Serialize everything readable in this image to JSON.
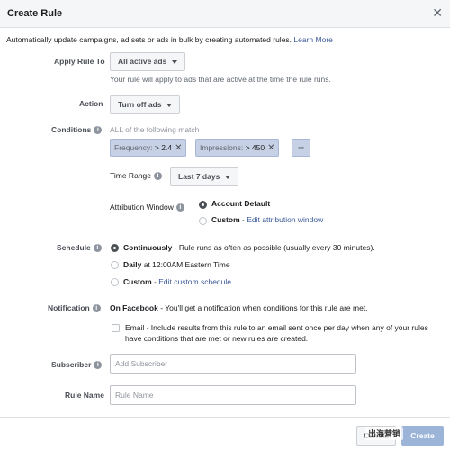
{
  "dialog": {
    "title": "Create Rule",
    "close_icon": "close-icon"
  },
  "intro": {
    "text": "Automatically update campaigns, ad sets or ads in bulk by creating automated rules. ",
    "link": "Learn More"
  },
  "apply_rule": {
    "label": "Apply Rule To",
    "value": "All active ads",
    "helper": "Your rule will apply to ads that are active at the time the rule runs."
  },
  "action": {
    "label": "Action",
    "value": "Turn off ads"
  },
  "conditions": {
    "label": "Conditions",
    "match_text": "ALL of the following match",
    "items": [
      {
        "metric": "Frequency:",
        "operator": ">",
        "value": "2.4"
      },
      {
        "metric": "Impressions:",
        "operator": ">",
        "value": "450"
      }
    ],
    "add_label": "+"
  },
  "time_range": {
    "label": "Time Range",
    "value": "Last 7 days"
  },
  "attribution": {
    "label": "Attribution Window",
    "options": [
      {
        "label": "Account Default",
        "suffix": "",
        "link": "",
        "checked": true
      },
      {
        "label": "Custom",
        "suffix": " - ",
        "link": "Edit attribution window",
        "checked": false
      }
    ]
  },
  "schedule": {
    "label": "Schedule",
    "options": [
      {
        "label": "Continuously",
        "detail": " - Rule runs as often as possible (usually every 30 minutes).",
        "link": "",
        "checked": true
      },
      {
        "label": "Daily",
        "detail": " at 12:00AM Eastern Time",
        "link": "",
        "checked": false
      },
      {
        "label": "Custom",
        "detail": " - ",
        "link": "Edit custom schedule",
        "checked": false
      }
    ]
  },
  "notification": {
    "label": "Notification",
    "facebook_label": "On Facebook",
    "facebook_detail": " - You'll get a notification when conditions for this rule are met.",
    "email_line1": "Email - Include results from this rule to an email sent once per day when any of your rules",
    "email_line2": "have conditions that are met or new rules are created."
  },
  "subscriber": {
    "label": "Subscriber",
    "placeholder": "Add Subscriber"
  },
  "rule_name": {
    "label": "Rule Name",
    "placeholder": "Rule Name"
  },
  "footer": {
    "cancel": "Cancel",
    "create": "Create",
    "watermark": "出海营销"
  },
  "colors": {
    "link": "#385898",
    "chip": "#c7d1e6",
    "primary_disabled": "#9cb4d8"
  }
}
